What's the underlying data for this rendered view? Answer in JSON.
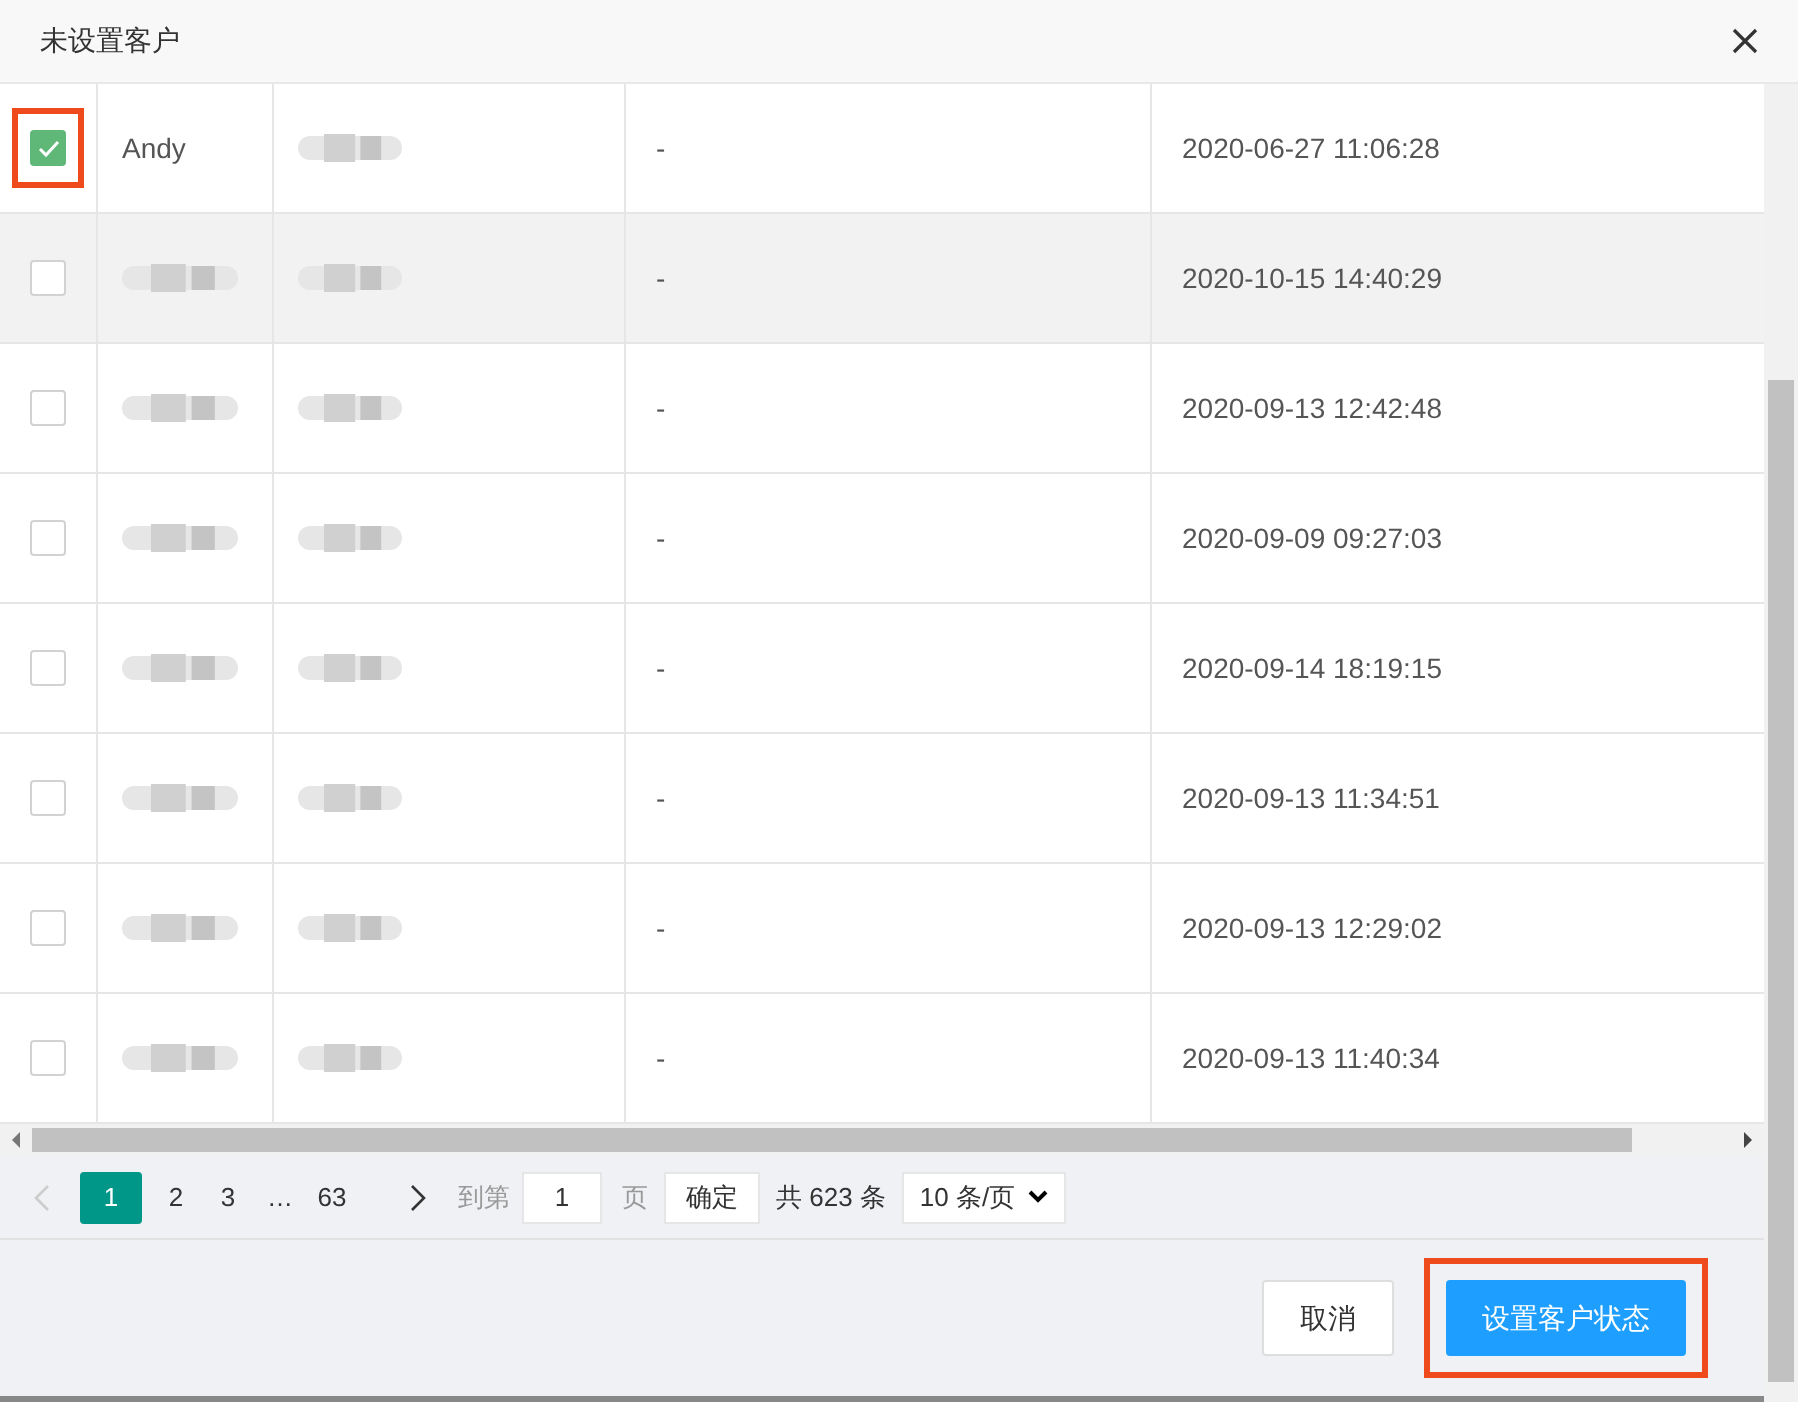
{
  "dialog": {
    "title": "未设置客户"
  },
  "table": {
    "rows": [
      {
        "checked": true,
        "highlighted": true,
        "hovered": false,
        "name": "Andy",
        "name_blurred": false,
        "contact_blurred": true,
        "column_4": "-",
        "time": "2020-06-27 11:06:28"
      },
      {
        "checked": false,
        "highlighted": false,
        "hovered": true,
        "name_blurred": true,
        "contact_blurred": true,
        "column_4": "-",
        "time": "2020-10-15 14:40:29"
      },
      {
        "checked": false,
        "highlighted": false,
        "hovered": false,
        "name_blurred": true,
        "contact_blurred": true,
        "column_4": "-",
        "time": "2020-09-13 12:42:48"
      },
      {
        "checked": false,
        "highlighted": false,
        "hovered": false,
        "name_blurred": true,
        "contact_blurred": true,
        "column_4": "-",
        "time": "2020-09-09 09:27:03"
      },
      {
        "checked": false,
        "highlighted": false,
        "hovered": false,
        "name_blurred": true,
        "contact_blurred": true,
        "column_4": "-",
        "time": "2020-09-14 18:19:15"
      },
      {
        "checked": false,
        "highlighted": false,
        "hovered": false,
        "name_blurred": true,
        "contact_blurred": true,
        "column_4": "-",
        "time": "2020-09-13 11:34:51"
      },
      {
        "checked": false,
        "highlighted": false,
        "hovered": false,
        "name_blurred": true,
        "contact_blurred": true,
        "column_4": "-",
        "time": "2020-09-13 12:29:02"
      },
      {
        "checked": false,
        "highlighted": false,
        "hovered": false,
        "name_blurred": true,
        "contact_blurred": true,
        "column_4": "-",
        "time": "2020-09-13 11:40:34"
      }
    ]
  },
  "pagination": {
    "pages": [
      {
        "label": "1",
        "selected": true
      },
      {
        "label": "2",
        "selected": false
      },
      {
        "label": "3",
        "selected": false
      },
      {
        "label": "…",
        "selected": false
      },
      {
        "label": "63",
        "selected": false
      }
    ],
    "goto_label": "到第",
    "goto_value": "1",
    "page_unit": "页",
    "confirm": "确定",
    "total": "共 623 条",
    "page_size": "10 条/页"
  },
  "buttons": [
    {
      "label": "取消",
      "kind": "default",
      "highlighted": false
    },
    {
      "label": "设置客户状态",
      "kind": "primary",
      "highlighted": true
    }
  ]
}
